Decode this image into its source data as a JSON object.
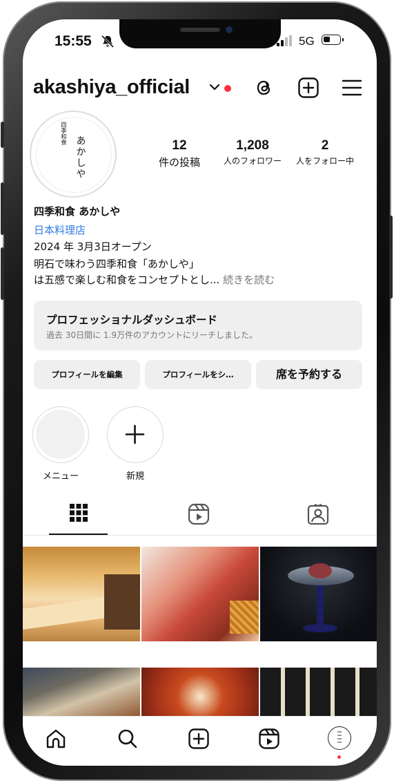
{
  "status_bar": {
    "time": "15:55",
    "network": "5G",
    "battery_level": 0.45
  },
  "header": {
    "username": "akashiya_official"
  },
  "profile": {
    "avatar_logo": {
      "small": "四季和食",
      "big": "あかしや"
    },
    "stats": [
      {
        "value": "12",
        "label": "件の投稿"
      },
      {
        "value": "1,208",
        "label": "人のフォロワー"
      },
      {
        "value": "2",
        "label": "人をフォロー中"
      }
    ],
    "name": "四季和食 あかしや",
    "category": "日本料理店",
    "bio_lines": [
      "2024 年 3月3日オープン",
      "明石で味わう四季和食「あかしや」",
      "は五感で楽しむ和食をコンセプトとし..."
    ],
    "more_label": "続きを読む"
  },
  "dashboard": {
    "title": "プロフェッショナルダッシュボード",
    "subtitle": "過去 30日間に 1.9万件のアカウントにリーチしました。"
  },
  "buttons": {
    "edit": "プロフィールを編集",
    "share": "プロフィールをシ…",
    "reserve": "席を予約する"
  },
  "highlights": [
    {
      "label": "メニュー"
    },
    {
      "label": "新規"
    }
  ],
  "colors": {
    "accent_red": "#ff3040",
    "link_blue": "#2f7be0",
    "button_gray": "#efefef"
  }
}
